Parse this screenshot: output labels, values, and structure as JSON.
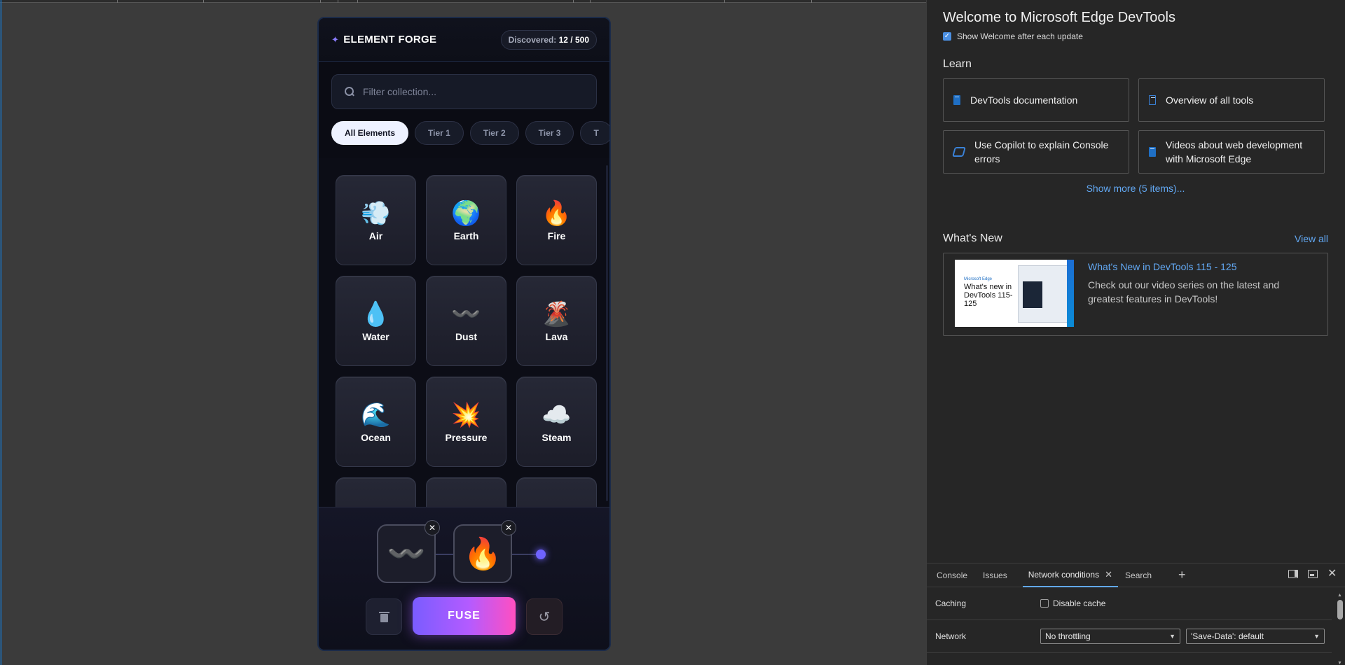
{
  "app": {
    "title": "ELEMENT FORGE",
    "discovered_label": "Discovered:",
    "discovered_value": "12 / 500",
    "search_placeholder": "Filter collection...",
    "chips": [
      {
        "label": "All Elements",
        "active": true
      },
      {
        "label": "Tier 1",
        "active": false
      },
      {
        "label": "Tier 2",
        "active": false
      },
      {
        "label": "Tier 3",
        "active": false
      },
      {
        "label": "T",
        "active": false
      }
    ],
    "elements": [
      {
        "name": "Air",
        "icon": "💨"
      },
      {
        "name": "Earth",
        "icon": "🌍"
      },
      {
        "name": "Fire",
        "icon": "🔥"
      },
      {
        "name": "Water",
        "icon": "💧"
      },
      {
        "name": "Dust",
        "icon": "〰️"
      },
      {
        "name": "Lava",
        "icon": "🌋"
      },
      {
        "name": "Ocean",
        "icon": "🌊"
      },
      {
        "name": "Pressure",
        "icon": "💥"
      },
      {
        "name": "Steam",
        "icon": "☁️"
      }
    ],
    "slots": [
      {
        "icon": "〰️"
      },
      {
        "icon": "🔥"
      }
    ],
    "fuse_label": "FUSE",
    "accent": "#7a5cff"
  },
  "devtools": {
    "welcome_title": "Welcome to Microsoft Edge DevTools",
    "show_welcome": "Show Welcome after each update",
    "learn_title": "Learn",
    "learn_items": [
      {
        "label": "DevTools documentation",
        "icon": "book-icon"
      },
      {
        "label": "Overview of all tools",
        "icon": "phone-icon"
      },
      {
        "label": "Use Copilot to explain Console errors",
        "icon": "copilot-icon"
      },
      {
        "label": "Videos about web development with Microsoft Edge",
        "icon": "book-icon"
      }
    ],
    "show_more": "Show more (5 items)...",
    "whats_new_title": "What's New",
    "view_all": "View all",
    "news": {
      "thumb_brand": "Microsoft Edge",
      "thumb_title": "What's new in DevTools 115-125",
      "title": "What's New in DevTools 115 - 125",
      "desc": "Check out our video series on the latest and greatest features in DevTools!"
    },
    "drawer": {
      "tabs": [
        "Console",
        "Issues",
        "Network conditions",
        "Search"
      ],
      "caching_label": "Caching",
      "disable_cache": "Disable cache",
      "network_label": "Network",
      "throttling": "No throttling",
      "save_data": "'Save-Data': default"
    }
  }
}
